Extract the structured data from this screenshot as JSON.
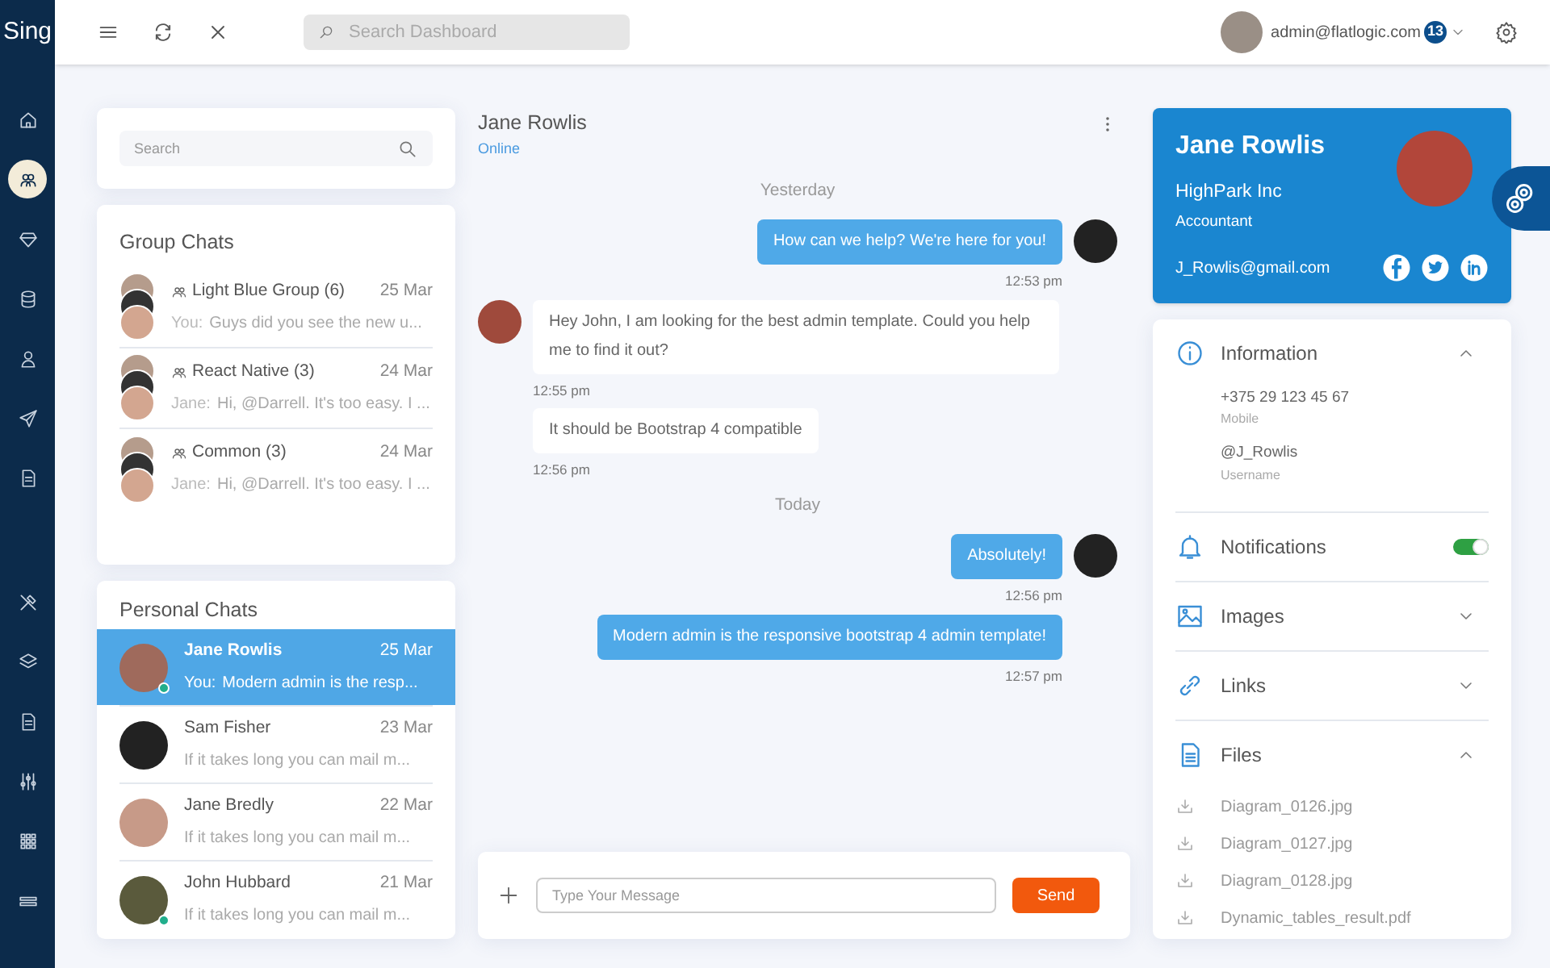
{
  "brand": "Sing",
  "nav": [
    {
      "selected": false
    },
    {
      "selected": true
    },
    {
      "selected": false
    },
    {
      "selected": false
    },
    {
      "selected": false
    },
    {
      "selected": false
    },
    {
      "selected": false
    },
    {
      "selected": false
    },
    {
      "selected": false
    },
    {
      "selected": false
    },
    {
      "selected": false
    },
    {
      "selected": false
    },
    {
      "selected": false
    }
  ],
  "topbar": {
    "search_placeholder": "Search Dashboard",
    "user": "admin@flatlogic.com",
    "badge": "13"
  },
  "chat_search": {
    "placeholder": "Search"
  },
  "group_chats": {
    "title": "Group Chats",
    "items": [
      {
        "name": "Light Blue Group (6)",
        "date": "25 Mar",
        "sender": "You:",
        "preview": "Guys did you see the new u..."
      },
      {
        "name": "React Native (3)",
        "date": "24 Mar",
        "sender": "Jane:",
        "preview": "Hi, @Darrell. It's too easy. I ..."
      },
      {
        "name": "Common (3)",
        "date": "24 Mar",
        "sender": "Jane:",
        "preview": "Hi, @Darrell. It's too easy. I ..."
      }
    ]
  },
  "personal_chats": {
    "title": "Personal Chats",
    "items": [
      {
        "name": "Jane Rowlis",
        "date": "25 Mar",
        "sender": "You:",
        "preview": "Modern admin is the resp...",
        "online": true,
        "selected": true
      },
      {
        "name": "Sam Fisher",
        "date": "23 Mar",
        "preview": "If it takes long you can mail m...",
        "online": false,
        "selected": false
      },
      {
        "name": "Jane Bredly",
        "date": "22 Mar",
        "preview": "If it takes long you can mail m...",
        "online": false,
        "selected": false
      },
      {
        "name": "John Hubbard",
        "date": "21 Mar",
        "preview": "If it takes long you can mail m...",
        "online": true,
        "selected": false
      }
    ]
  },
  "conversation": {
    "name": "Jane Rowlis",
    "status": "Online",
    "messages": [
      {
        "kind": "day",
        "text": "Yesterday"
      },
      {
        "kind": "outgoing",
        "text": "How can we help? We're here for you!",
        "time": "12:53 pm",
        "avatar": true
      },
      {
        "kind": "incoming",
        "text": "Hey John, I am looking for the best admin template. Could you help me to find it out?",
        "time": "12:55 pm",
        "avatar": true
      },
      {
        "kind": "incoming",
        "text": "It should be Bootstrap 4 compatible",
        "time": "12:56 pm",
        "avatar": false
      },
      {
        "kind": "day",
        "text": "Today"
      },
      {
        "kind": "outgoing",
        "text": "Absolutely!",
        "time": "12:56 pm",
        "avatar": true
      },
      {
        "kind": "outgoing",
        "text": "Modern admin is the responsive bootstrap 4 admin template!",
        "time": "12:57 pm",
        "avatar": false
      }
    ],
    "input_placeholder": "Type Your Message",
    "send": "Send"
  },
  "profile": {
    "name": "Jane Rowlis",
    "company": "HighPark Inc",
    "position": "Accountant",
    "email": "J_Rowlis@gmail.com"
  },
  "sections": [
    {
      "kind": "expand",
      "title": "Information",
      "expanded": true,
      "fields": [
        {
          "value": "+375 29 123 45 67",
          "label": "Mobile"
        },
        {
          "value": "@J_Rowlis",
          "label": "Username"
        }
      ]
    },
    {
      "kind": "toggle",
      "title": "Notifications",
      "on": true
    },
    {
      "kind": "expand",
      "title": "Images",
      "expanded": false
    },
    {
      "kind": "expand",
      "title": "Links",
      "expanded": false
    },
    {
      "kind": "expand",
      "title": "Files",
      "expanded": true,
      "files": [
        "Diagram_0126.jpg",
        "Diagram_0127.jpg",
        "Diagram_0128.jpg",
        "Dynamic_tables_result.pdf"
      ]
    }
  ]
}
